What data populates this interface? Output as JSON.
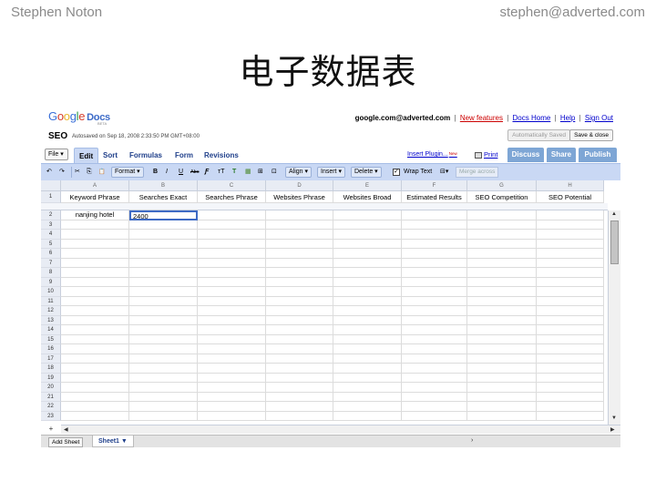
{
  "slide": {
    "author": "Stephen Noton",
    "email": "stephen@adverted.com",
    "title": "电子数据表"
  },
  "app": {
    "logo_text": "Google Docs",
    "logo_beta": "BETA",
    "account": "google.com@adverted.com",
    "top_links": [
      "New features",
      "Docs Home",
      "Help",
      "Sign Out"
    ],
    "doc_title": "SEO",
    "autosave": "Autosaved on Sep 18, 2008 2:33:50 PM GMT+08:00",
    "autosaved_button": "Automatically Saved",
    "save_close_button": "Save & close",
    "file_menu": "File",
    "tabs": [
      "Edit",
      "Sort",
      "Formulas",
      "Form",
      "Revisions"
    ],
    "active_tab": "Edit",
    "insert_plugin": "Insert Plugin...",
    "new_badge": "New",
    "print": "Print",
    "action_buttons": [
      "Discuss",
      "Share",
      "Publish"
    ]
  },
  "toolbar": {
    "undo": "↶",
    "redo": "↷",
    "cut": "✂",
    "copy": "⎘",
    "paste": "📋",
    "format": "Format",
    "bold": "B",
    "italic": "I",
    "underline": "U",
    "strike": "Abc",
    "font": "Ƒ",
    "font_size": "ᴛT",
    "text_color": "T",
    "bg_color": "▦",
    "borders": "⊞",
    "align": "Align",
    "insert": "Insert",
    "delete": "Delete",
    "wrap_text": "Wrap Text",
    "merge": "Merge across"
  },
  "sheet": {
    "columns": [
      "A",
      "B",
      "C",
      "D",
      "E",
      "F",
      "G",
      "H"
    ],
    "header_row": [
      "Keyword Phrase",
      "Searches Exact",
      "Searches Phrase",
      "Websites Phrase",
      "Websites Broad",
      "Estimated Results",
      "SEO Competition",
      "SEO Potential"
    ],
    "row2": [
      "nanjing hotel",
      "2400",
      "",
      "",
      "",
      "",
      "",
      ""
    ],
    "row_numbers": [
      "1",
      "2",
      "3",
      "4",
      "5",
      "6",
      "7",
      "8",
      "9",
      "10",
      "11",
      "12",
      "13",
      "14",
      "15",
      "16",
      "17",
      "18",
      "19",
      "20",
      "21",
      "22",
      "23"
    ],
    "add_row": "+",
    "add_sheet": "Add Sheet",
    "sheet_tab": "Sheet1 ▼"
  }
}
